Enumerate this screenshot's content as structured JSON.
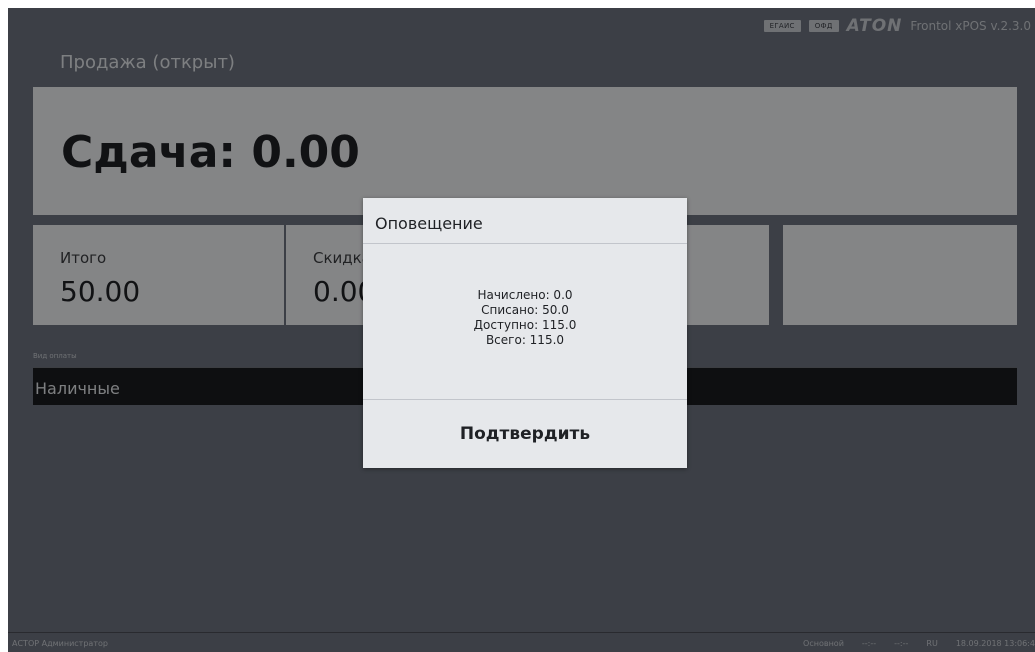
{
  "header": {
    "badges": [
      "ЕГАИС",
      "ОФД"
    ],
    "logo": "ATON",
    "version": "Frontol xPOS v.2.3.0"
  },
  "page_title": "Продажа (открыт)",
  "change": {
    "text": "Сдача: 0.00"
  },
  "tiles": [
    {
      "label": "Итого",
      "value": "50.00"
    },
    {
      "label": "Скидка",
      "value": "0.00"
    },
    {
      "label": "",
      "value": ""
    },
    {
      "label": "",
      "value": ""
    }
  ],
  "payment": {
    "caption": "Вид оплаты",
    "value": "Наличные"
  },
  "status": {
    "user": "АСТОР  Администратор",
    "mode": "Основной",
    "slot1": "--:--",
    "slot2": "--:--",
    "lang": "RU",
    "datetime": "18.09.2018 13:06:4"
  },
  "dialog": {
    "title": "Оповещение",
    "lines": [
      "Начислено: 0.0",
      "Списано: 50.0",
      "Доступно: 115.0",
      "Всего: 115.0"
    ],
    "confirm_label": "Подтвердить"
  }
}
